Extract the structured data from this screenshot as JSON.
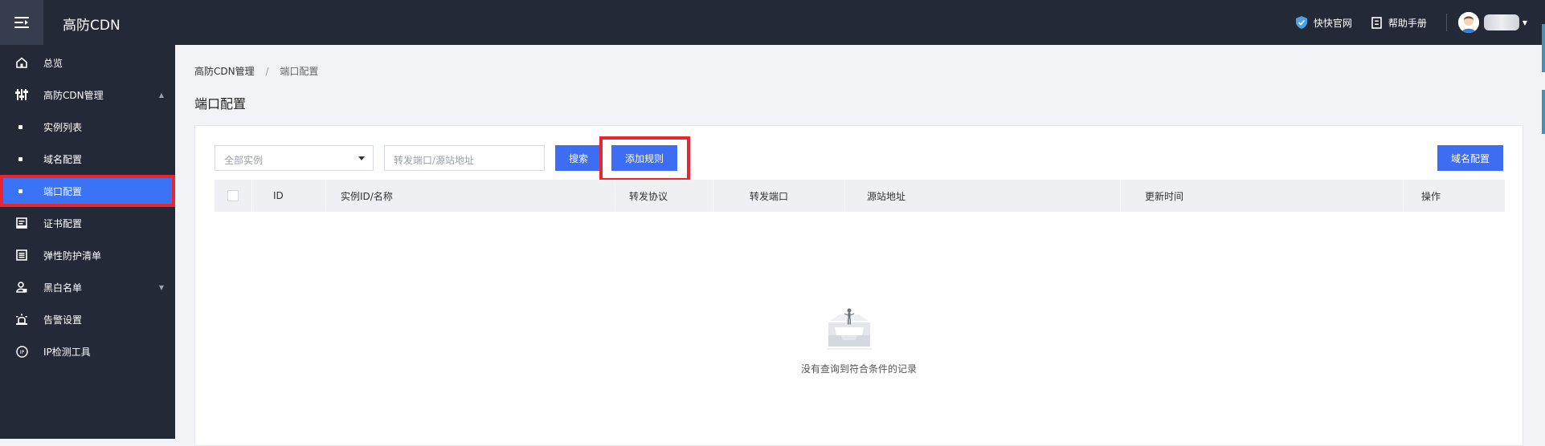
{
  "app": {
    "title": "高防CDN"
  },
  "header": {
    "links": [
      {
        "label": "快快官网",
        "icon": "shield-icon"
      },
      {
        "label": "帮助手册",
        "icon": "manual-icon"
      }
    ]
  },
  "sidebar": {
    "items": [
      {
        "label": "总览",
        "icon": "home-icon"
      },
      {
        "label": "高防CDN管理",
        "icon": "sliders-icon"
      },
      {
        "label": "实例列表"
      },
      {
        "label": "域名配置"
      },
      {
        "label": "端口配置"
      },
      {
        "label": "证书配置",
        "icon": "certificate-icon"
      },
      {
        "label": "弹性防护清单",
        "icon": "list-icon"
      },
      {
        "label": "黑白名单",
        "icon": "user-lock-icon"
      },
      {
        "label": "告警设置",
        "icon": "alarm-icon"
      },
      {
        "label": "IP检测工具",
        "icon": "ip-icon"
      }
    ]
  },
  "breadcrumb": {
    "root": "高防CDN管理",
    "sep": "/",
    "current": "端口配置"
  },
  "page": {
    "title": "端口配置"
  },
  "toolbar": {
    "instance_select": "全部实例",
    "port_placeholder": "转发端口/源站地址",
    "search_label": "搜索",
    "add_label": "添加规则",
    "domain_config_label": "域名配置"
  },
  "table": {
    "columns": [
      "ID",
      "实例ID/名称",
      "转发协议",
      "转发端口",
      "源站地址",
      "更新时间",
      "操作"
    ],
    "empty_text": "没有查询到符合条件的记录"
  },
  "colors": {
    "accent": "#3d6df2",
    "highlight": "#e8262f",
    "sidebar": "#232937"
  }
}
